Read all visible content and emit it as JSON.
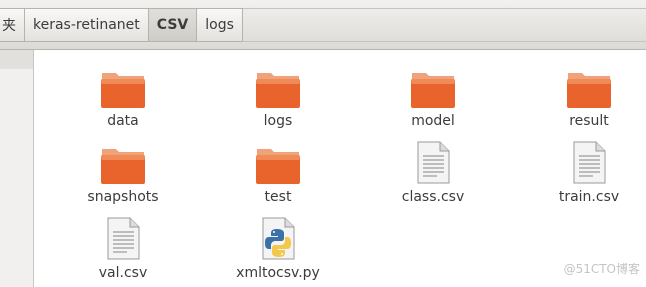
{
  "breadcrumb": [
    "夹",
    "keras-retinanet",
    "CSV",
    "logs"
  ],
  "files": [
    {
      "name": "data",
      "type": "folder"
    },
    {
      "name": "logs",
      "type": "folder"
    },
    {
      "name": "model",
      "type": "folder"
    },
    {
      "name": "result",
      "type": "folder"
    },
    {
      "name": "snapshots",
      "type": "folder"
    },
    {
      "name": "test",
      "type": "folder"
    },
    {
      "name": "class.csv",
      "type": "text"
    },
    {
      "name": "train.csv",
      "type": "text"
    },
    {
      "name": "val.csv",
      "type": "text"
    },
    {
      "name": "xmltocsv.py",
      "type": "python"
    }
  ],
  "watermark": "@51CTO博客",
  "colors": {
    "folder": "#e8642c",
    "folder_tab": "#f0a27a",
    "selected_crumb": "#d2d0cb"
  }
}
